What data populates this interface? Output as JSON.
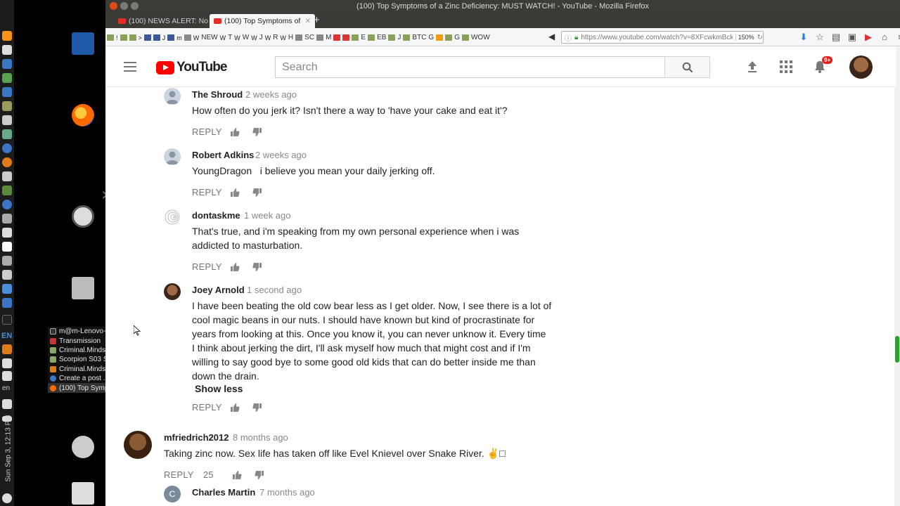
{
  "window": {
    "title": "(100) Top Symptoms of a Zinc Deficiency: MUST WATCH! - YouTube - Mozilla Firefox"
  },
  "tabs": [
    {
      "label": "(100) NEWS ALERT: No",
      "active": false
    },
    {
      "label": "(100) Top Symptoms of",
      "active": true
    }
  ],
  "bookmarks": [
    "NEW",
    "T",
    "W",
    "J",
    "R",
    "H",
    "SC",
    "M",
    "E",
    "EB",
    "J",
    "BTC",
    "G",
    "G",
    "WOW"
  ],
  "urlbar": {
    "url": "https://www.youtube.com/watch?v=8XFcwkmBck",
    "zoom": "150%"
  },
  "youtube": {
    "logo_text": "YouTube",
    "search_placeholder": "Search",
    "notifications_badge": "9+"
  },
  "comments": [
    {
      "author": "The Shroud",
      "time": "2 weeks ago",
      "lines": [
        "How often do you jerk it? Isn't there a way to 'have your cake and eat it'?"
      ],
      "reply_label": "REPLY"
    },
    {
      "author": "Robert Adkins",
      "time": "2 weeks ago",
      "lines": [
        "YoungDragon   i believe you mean your daily jerking off."
      ],
      "reply_label": "REPLY"
    },
    {
      "author": "dontaskme",
      "time": "1 week ago",
      "lines": [
        "That's true, and i'm speaking from my own personal experience when i was",
        "addicted to masturbation."
      ],
      "reply_label": "REPLY"
    },
    {
      "author": "Joey Arnold",
      "time": "1 second ago",
      "lines": [
        "I have been beating the old cow bear less as I get older. Now, I see there is a lot of",
        "cool magic beans in our nuts. I should have known but kind of procrastinate for",
        "years from looking at this. Once you know it, you can never unknow it. Every time",
        "I think about jerking the dirt, I'll ask myself how much that might cost and if I'm",
        "willing to say good bye to some good old kids that can do better inside me than",
        "down the drain."
      ],
      "show_less": "Show less",
      "reply_label": "REPLY"
    },
    {
      "author": "mfriedrich2012",
      "time": "8 months ago",
      "lines": [
        "Taking zinc now. Sex life has taken off like Evel Knievel over Snake River. ✌□"
      ],
      "reply_label": "REPLY",
      "like_count": "25"
    },
    {
      "author": "Charles Martin",
      "time": "7 months ago",
      "avatar_letter": "C",
      "lines": [],
      "reply_label": ""
    }
  ],
  "taskbar": {
    "items": [
      "m@m-Lenovo-...",
      "Transmission",
      "Criminal.Minds...",
      "Scorpion S03 S...",
      "Criminal.Minds...",
      "Create a post ...",
      "(100) Top Symp..."
    ],
    "active_index": 6,
    "lang": "EN",
    "lang_short": "en",
    "clock": "Sun Sep 3, 12:13 PM"
  },
  "colors": {
    "youtube_red": "#ff0000",
    "scroll_green": "#2da12d"
  }
}
